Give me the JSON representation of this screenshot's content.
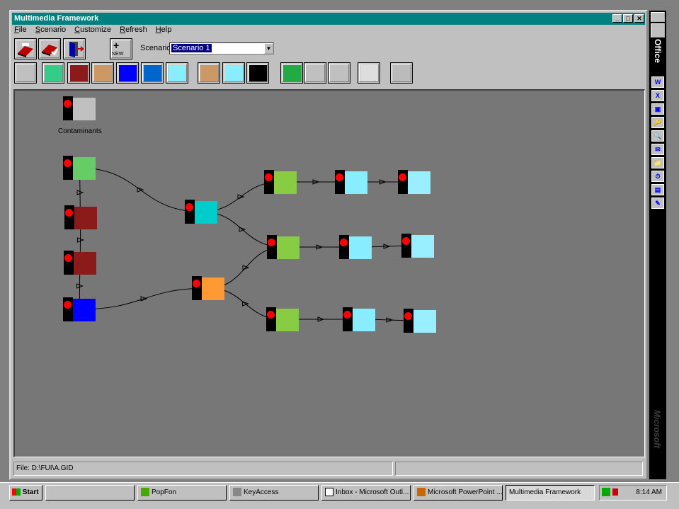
{
  "window": {
    "title": "Multimedia Framework",
    "min_label": "_",
    "max_label": "□",
    "close_label": "✕"
  },
  "menu": [
    "File",
    "Scenario",
    "Customize",
    "Refresh",
    "Help"
  ],
  "toolbar": {
    "new_label": "NEW",
    "scenario_label": "Scenario:",
    "scenario_value": "Scenario 1"
  },
  "palette_icons": [
    "contaminant-source-icon",
    "aquifer-icon",
    "vadose-zone-icon",
    "unsaturated-icon",
    "overland-icon",
    "surface-water-icon",
    "river-icon",
    "air-icon",
    "exposure-icon",
    "receptor-icon",
    "health-icon",
    "sensitivity-icon",
    "query-arrow-icon",
    "query-bar-icon",
    "graph-icon",
    "trash-icon"
  ],
  "canvas": {
    "label_contaminants": "Contaminants",
    "nodes": [
      {
        "name": "contaminants-node",
        "icon": "radiation-icon"
      },
      {
        "name": "source-node",
        "icon": "source-icon"
      },
      {
        "name": "vadose-node-1",
        "icon": "vadose-icon"
      },
      {
        "name": "vadose-node-2",
        "icon": "vadose-icon"
      },
      {
        "name": "aquifer-node",
        "icon": "aquifer-icon"
      },
      {
        "name": "air-node",
        "icon": "air-icon"
      },
      {
        "name": "river-node",
        "icon": "river-icon"
      },
      {
        "name": "exposure-node-1",
        "icon": "exposure-icon"
      },
      {
        "name": "exposure-node-2",
        "icon": "exposure-icon"
      },
      {
        "name": "exposure-node-3",
        "icon": "exposure-icon"
      },
      {
        "name": "intake-node-1",
        "icon": "intake-icon"
      },
      {
        "name": "intake-node-2",
        "icon": "intake-icon"
      },
      {
        "name": "intake-node-3",
        "icon": "intake-icon"
      },
      {
        "name": "health-node-1",
        "icon": "health-icon"
      },
      {
        "name": "health-node-2",
        "icon": "health-icon"
      },
      {
        "name": "health-node-3",
        "icon": "health-icon"
      }
    ]
  },
  "status": {
    "file": "File: D:\\FUI\\A.GID",
    "panel2": ""
  },
  "officebar": {
    "label": "Office",
    "brand": "Microsoft",
    "icons": [
      "W",
      "X",
      "▣",
      "🔑",
      "🔍",
      "✉",
      "📁",
      "⏱",
      "▤",
      "✎"
    ]
  },
  "taskbar": {
    "start": "Start",
    "tasks": [
      "",
      "PopFon",
      "KeyAccess",
      "Inbox - Microsoft Outl...",
      "Microsoft PowerPoint ...",
      "Multimedia Framework"
    ],
    "clock": "8:14 AM"
  },
  "colors": {
    "titlebar": "#008080",
    "canvas": "#777777",
    "node_red": "#ff0000",
    "node_block": "#000000"
  }
}
